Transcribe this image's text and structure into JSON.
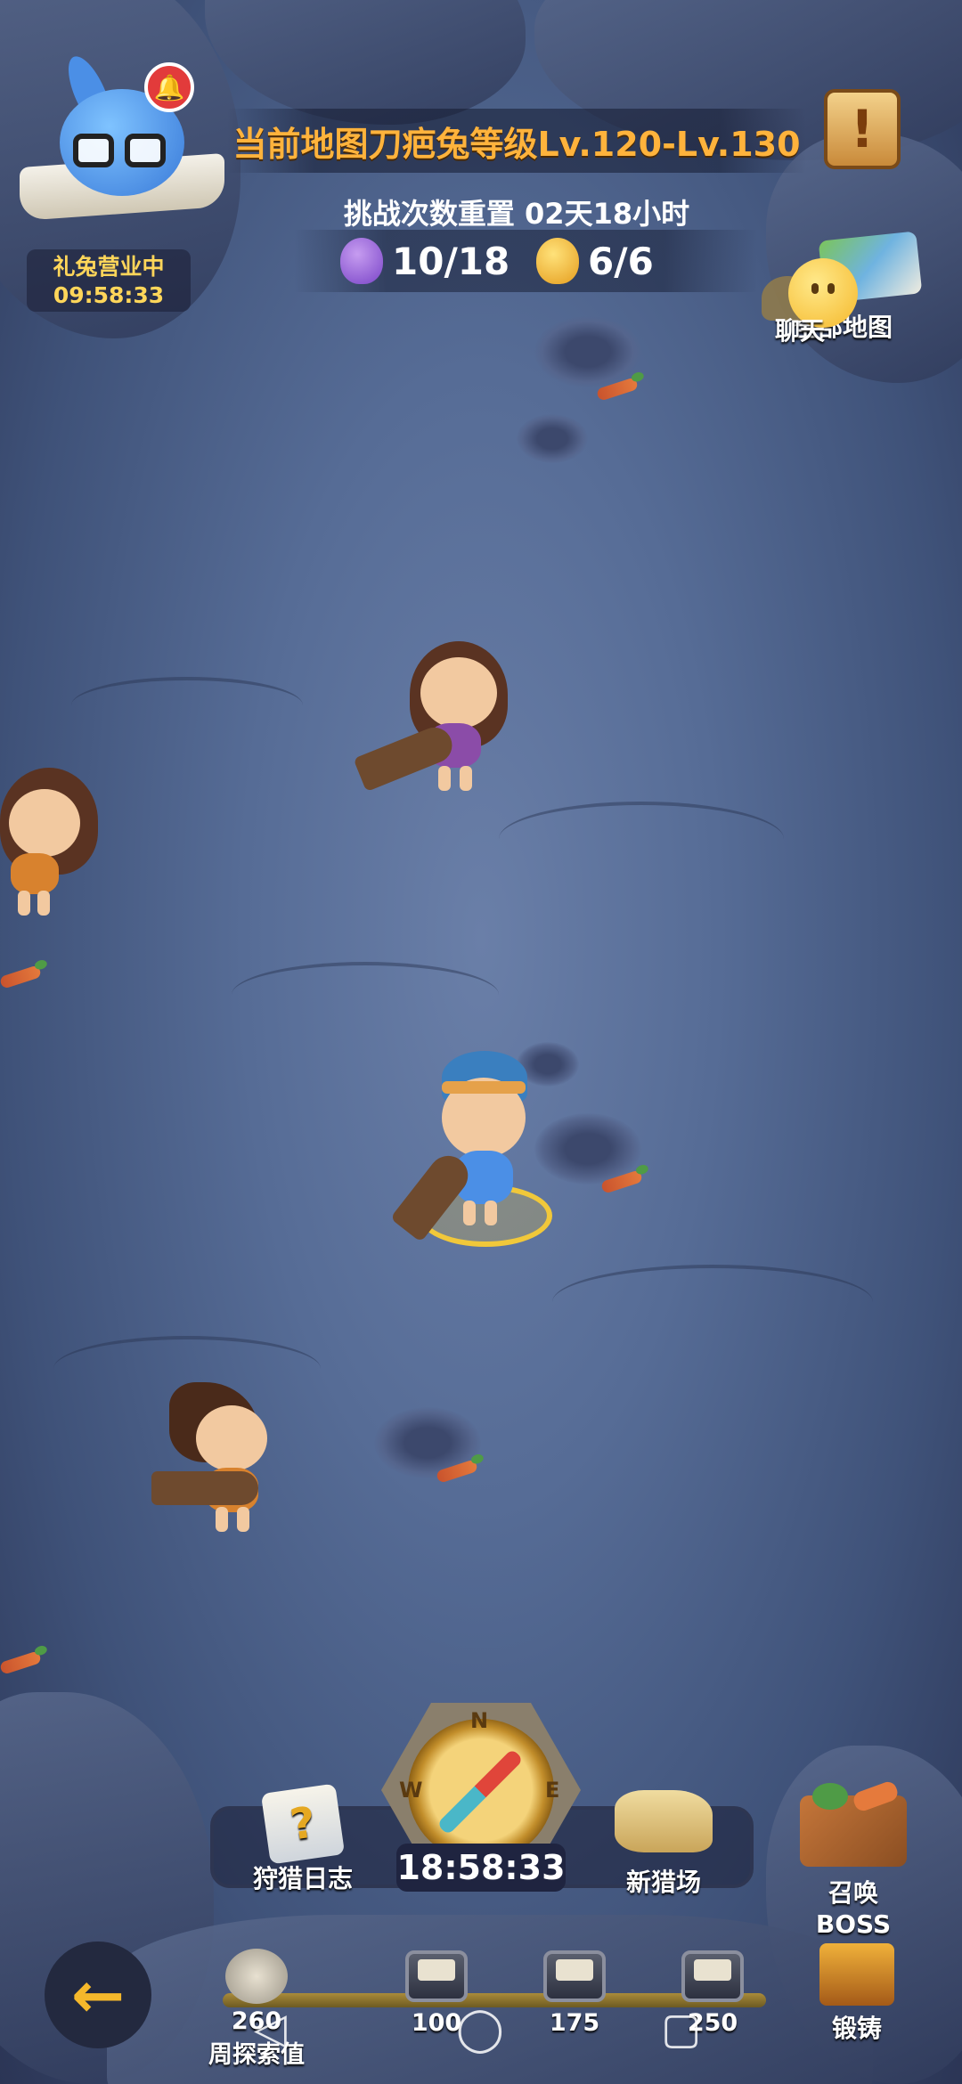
{
  "shop": {
    "status": "礼兔营业中",
    "time": "09:58:33"
  },
  "header": {
    "map_level": "当前地图刀疤兔等级Lv.120-Lv.130",
    "reset_text": "挑战次数重置 02天18小时",
    "purple_count": "10/18",
    "gold_count": "6/6",
    "quest_symbol": "!"
  },
  "right_menu": {
    "map_label": "全部地图",
    "chat_label": "聊天"
  },
  "bottom": {
    "hunt_log": "狩猎日志",
    "new_field": "新猎场",
    "summon_boss": "召唤BOSS",
    "timer": "18:58:33",
    "compass": {
      "n": "N",
      "w": "W",
      "e": "E"
    }
  },
  "progress": {
    "milestones": [
      "260",
      "100",
      "175",
      "250"
    ],
    "label": "周探索值",
    "forge": "锻铸"
  },
  "icons": {
    "back": "←",
    "nav_back": "◁",
    "nav_home": "◯",
    "nav_recent": "▢"
  },
  "colors": {
    "title_orange": "#ffb33c",
    "shop_yellow": "#ffd65a",
    "bell_red": "#e23b3b"
  }
}
